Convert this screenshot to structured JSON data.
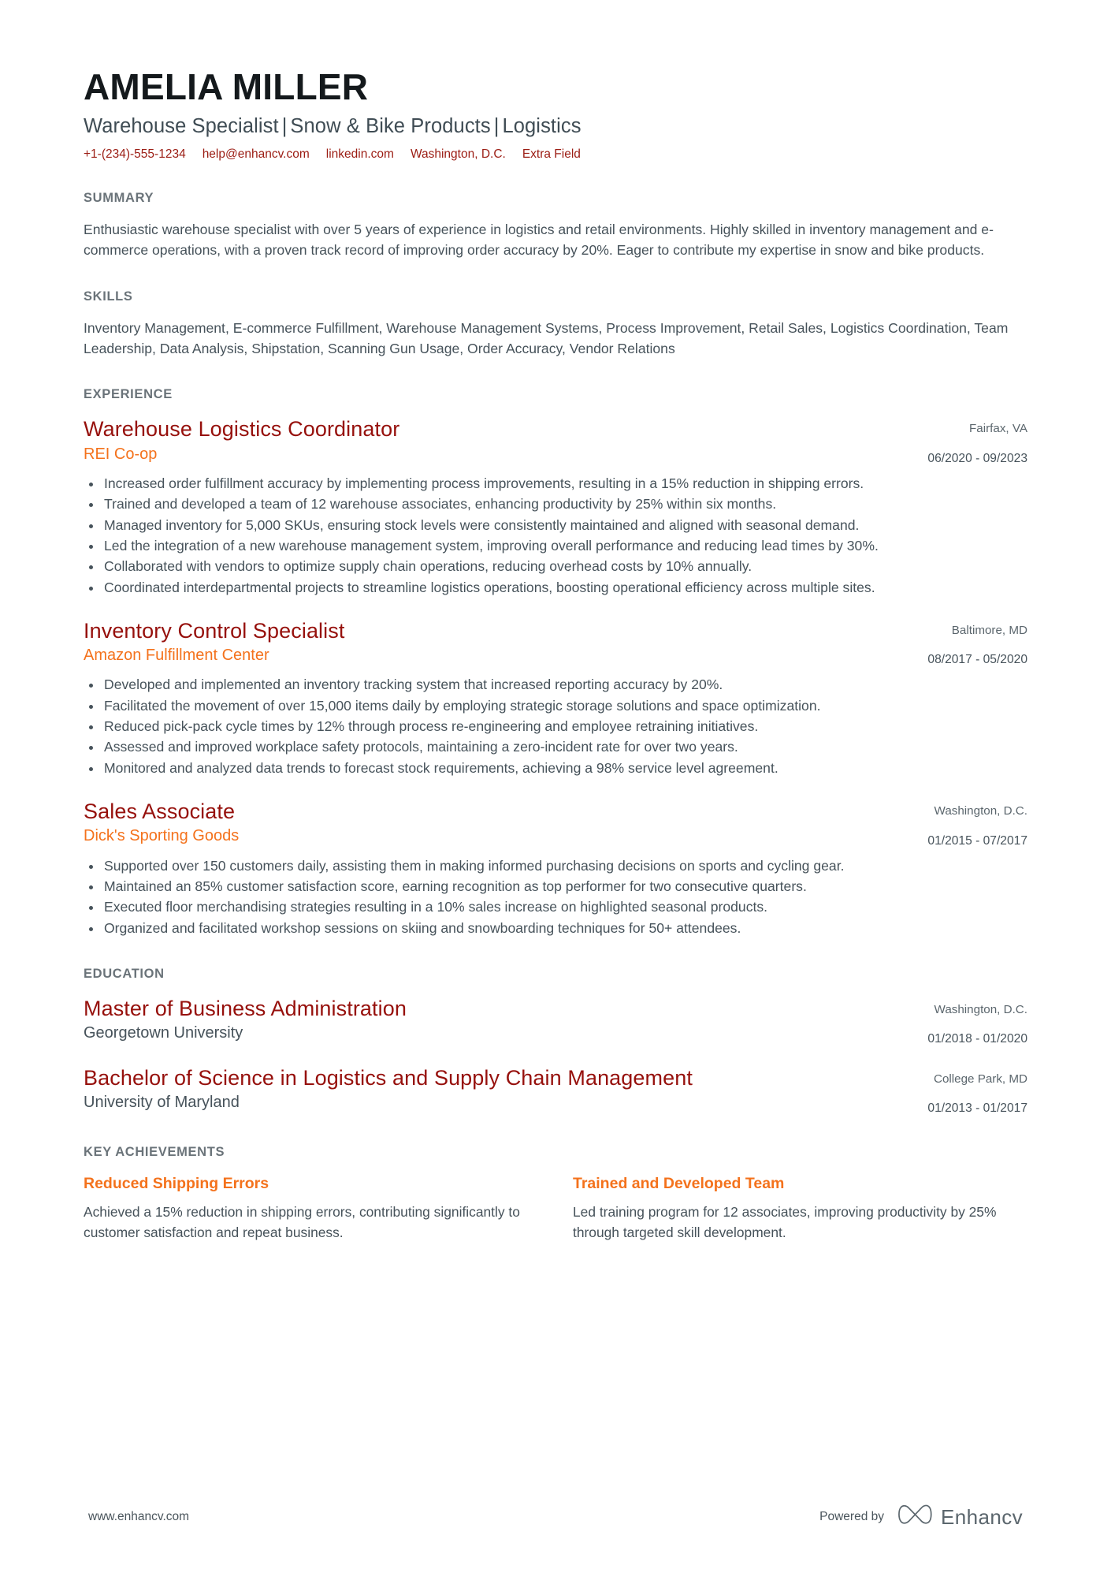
{
  "header": {
    "name": "AMELIA MILLER",
    "headline_parts": [
      "Warehouse Specialist",
      "Snow & Bike Products",
      "Logistics"
    ],
    "headline": "Warehouse Specialist | Snow & Bike Products | Logistics",
    "contacts": [
      {
        "label": "+1-(234)-555-1234",
        "kind": "phone"
      },
      {
        "label": "help@enhancv.com",
        "kind": "email"
      },
      {
        "label": "linkedin.com",
        "kind": "link"
      },
      {
        "label": "Washington, D.C.",
        "kind": "location"
      },
      {
        "label": "Extra Field",
        "kind": "extra"
      }
    ]
  },
  "sections": {
    "summary": {
      "title": "SUMMARY",
      "text": "Enthusiastic warehouse specialist with over 5 years of experience in logistics and retail environments. Highly skilled in inventory management and e-commerce operations, with a proven track record of improving order accuracy by 20%. Eager to contribute my expertise in snow and bike products."
    },
    "skills": {
      "title": "SKILLS",
      "text": "Inventory Management, E-commerce Fulfillment, Warehouse Management Systems, Process Improvement, Retail Sales, Logistics Coordination, Team Leadership, Data Analysis, Shipstation, Scanning Gun Usage, Order Accuracy, Vendor Relations"
    },
    "experience": {
      "title": "EXPERIENCE",
      "entries": [
        {
          "title": "Warehouse Logistics Coordinator",
          "company": "REI Co-op",
          "location": "Fairfax, VA",
          "dates": "06/2020 - 09/2023",
          "bullets": [
            "Increased order fulfillment accuracy by implementing process improvements, resulting in a 15% reduction in shipping errors.",
            "Trained and developed a team of 12 warehouse associates, enhancing productivity by 25% within six months.",
            "Managed inventory for 5,000 SKUs, ensuring stock levels were consistently maintained and aligned with seasonal demand.",
            "Led the integration of a new warehouse management system, improving overall performance and reducing lead times by 30%.",
            "Collaborated with vendors to optimize supply chain operations, reducing overhead costs by 10% annually.",
            "Coordinated interdepartmental projects to streamline logistics operations, boosting operational efficiency across multiple sites."
          ]
        },
        {
          "title": "Inventory Control Specialist",
          "company": "Amazon Fulfillment Center",
          "location": "Baltimore, MD",
          "dates": "08/2017 - 05/2020",
          "bullets": [
            "Developed and implemented an inventory tracking system that increased reporting accuracy by 20%.",
            "Facilitated the movement of over 15,000 items daily by employing strategic storage solutions and space optimization.",
            "Reduced pick-pack cycle times by 12% through process re-engineering and employee retraining initiatives.",
            "Assessed and improved workplace safety protocols, maintaining a zero-incident rate for over two years.",
            "Monitored and analyzed data trends to forecast stock requirements, achieving a 98% service level agreement."
          ]
        },
        {
          "title": "Sales Associate",
          "company": "Dick's Sporting Goods",
          "location": "Washington, D.C.",
          "dates": "01/2015 - 07/2017",
          "bullets": [
            "Supported over 150 customers daily, assisting them in making informed purchasing decisions on sports and cycling gear.",
            "Maintained an 85% customer satisfaction score, earning recognition as top performer for two consecutive quarters.",
            "Executed floor merchandising strategies resulting in a 10% sales increase on highlighted seasonal products.",
            "Organized and facilitated workshop sessions on skiing and snowboarding techniques for 50+ attendees."
          ]
        }
      ]
    },
    "education": {
      "title": "EDUCATION",
      "entries": [
        {
          "degree": "Master of Business Administration",
          "school": "Georgetown University",
          "location": "Washington, D.C.",
          "dates": "01/2018 - 01/2020"
        },
        {
          "degree": "Bachelor of Science in Logistics and Supply Chain Management",
          "school": "University of Maryland",
          "location": "College Park, MD",
          "dates": "01/2013 - 01/2017"
        }
      ]
    },
    "achievements": {
      "title": "KEY ACHIEVEMENTS",
      "items": [
        {
          "title": "Reduced Shipping Errors",
          "text": "Achieved a 15% reduction in shipping errors, contributing significantly to customer satisfaction and repeat business."
        },
        {
          "title": "Trained and Developed Team",
          "text": "Led training program for 12 associates, improving productivity by 25% through targeted skill development."
        }
      ]
    }
  },
  "footer": {
    "url": "www.enhancv.com",
    "powered_by": "Powered by",
    "brand": "Enhancv",
    "brand_icon": "enhancv-infinity-logo-icon"
  },
  "colors": {
    "accent_red": "#96100c",
    "accent_orange": "#f4721c",
    "contact_red": "#9b1c13",
    "heading_gray": "#6a7379",
    "body_gray": "#46525a",
    "name_black": "#14191c"
  }
}
